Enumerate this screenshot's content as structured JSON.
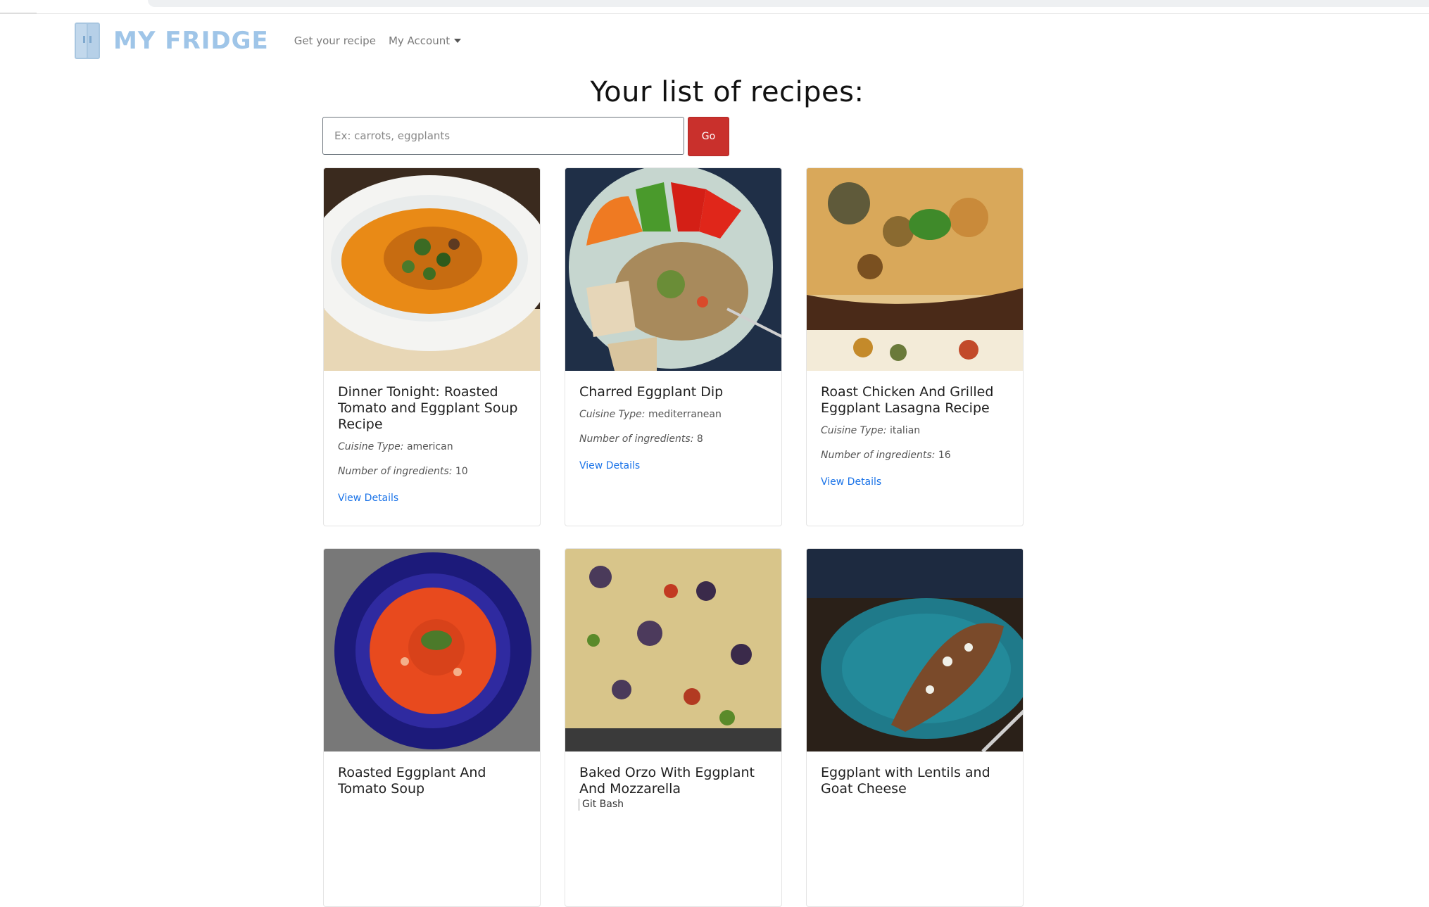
{
  "navbar": {
    "brand": "MY FRIDGE",
    "links": [
      "Get your recipe",
      "My Account"
    ]
  },
  "main": {
    "title": "Your list of recipes:",
    "search": {
      "placeholder": "Ex: carrots, eggplants",
      "value": "",
      "button_label": "Go"
    }
  },
  "recipes": [
    {
      "title": "Dinner Tonight: Roasted Tomato and Eggplant Soup Recipe",
      "cuisine_label": "Cuisine Type:",
      "cuisine": "american",
      "ingredients_label": "Number of ingredients:",
      "ingredients": "10",
      "link": "View Details"
    },
    {
      "title": "Charred Eggplant Dip",
      "cuisine_label": "Cuisine Type:",
      "cuisine": "mediterranean",
      "ingredients_label": "Number of ingredients:",
      "ingredients": "8",
      "link": "View Details"
    },
    {
      "title": "Roast Chicken And Grilled Eggplant Lasagna Recipe",
      "cuisine_label": "Cuisine Type:",
      "cuisine": "italian",
      "ingredients_label": "Number of ingredients:",
      "ingredients": "16",
      "link": "View Details"
    },
    {
      "title": "Roasted Eggplant And Tomato Soup"
    },
    {
      "title": "Baked Orzo With Eggplant And Mozzarella"
    },
    {
      "title": "Eggplant with Lentils and Goat Cheese"
    }
  ],
  "tooltip": "Git Bash",
  "colors": {
    "brand": "#9fc5e8",
    "go_button": "#c9302c",
    "link": "#1a73e8"
  }
}
